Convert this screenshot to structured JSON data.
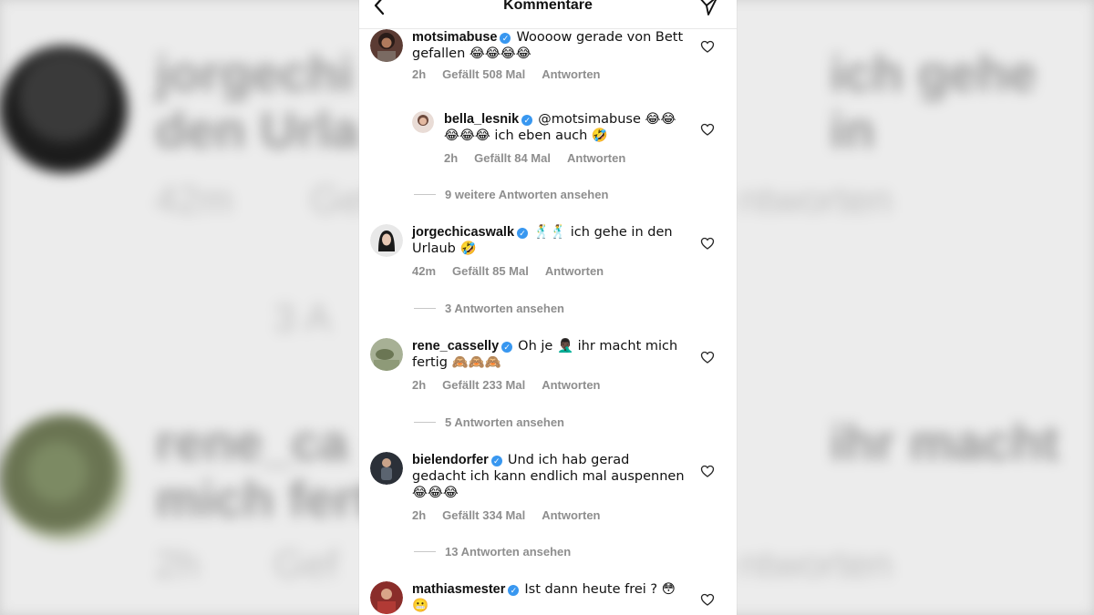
{
  "header": {
    "title": "Kommentare",
    "back_icon": "chevron-left-icon",
    "send_icon": "paper-plane-icon"
  },
  "comments": [
    {
      "username": "motsimabuse",
      "verified": true,
      "text": "Woooow gerade von Bett gefallen 😂😂😂😂",
      "time": "2h",
      "likes": "Gefällt 508 Mal",
      "reply": "Antworten"
    },
    {
      "username": "bella_lesnik",
      "verified": true,
      "text": "@motsimabuse 😂😂😂😂😂 ich eben auch 🤣",
      "time": "2h",
      "likes": "Gefällt 84 Mal",
      "reply": "Antworten"
    },
    {
      "username": "jorgechicaswalk",
      "verified": true,
      "text": "🕺🕺 ich gehe in den Urlaub 🤣",
      "time": "42m",
      "likes": "Gefällt 85 Mal",
      "reply": "Antworten"
    },
    {
      "username": "rene_casselly",
      "verified": true,
      "text": "Oh je 🤦🏿‍♂️ ihr macht mich fertig 🙈🙈🙈",
      "time": "2h",
      "likes": "Gefällt 233 Mal",
      "reply": "Antworten"
    },
    {
      "username": "bielendorfer",
      "verified": true,
      "text": "Und ich hab gerad gedacht ich kann endlich mal auspennen 😂😂😂",
      "time": "2h",
      "likes": "Gefällt 334 Mal",
      "reply": "Antworten"
    },
    {
      "username": "mathiasmester",
      "verified": true,
      "text": "Ist dann heute frei ? 😳😬",
      "time": "",
      "likes": "",
      "reply": ""
    }
  ],
  "threads": [
    "9 weitere Antworten ansehen",
    "3 Antworten ansehen",
    "5 Antworten ansehen",
    "13 Antworten ansehen"
  ],
  "background": {
    "line1": "jorgechi",
    "line1b": "ich gehe in",
    "line2": "den Urla",
    "meta1": "42m",
    "meta1b": "Gef",
    "meta1c": "ntworten",
    "thread": "3 A",
    "line3": "rene_ca",
    "line3b": "ihr macht",
    "line4": "mich fert",
    "meta2": "2h",
    "meta2b": "Gef",
    "meta2c": "ntworten"
  },
  "colors": {
    "verified": "#3897f0",
    "meta": "#8e8e8e",
    "text": "#111111"
  }
}
